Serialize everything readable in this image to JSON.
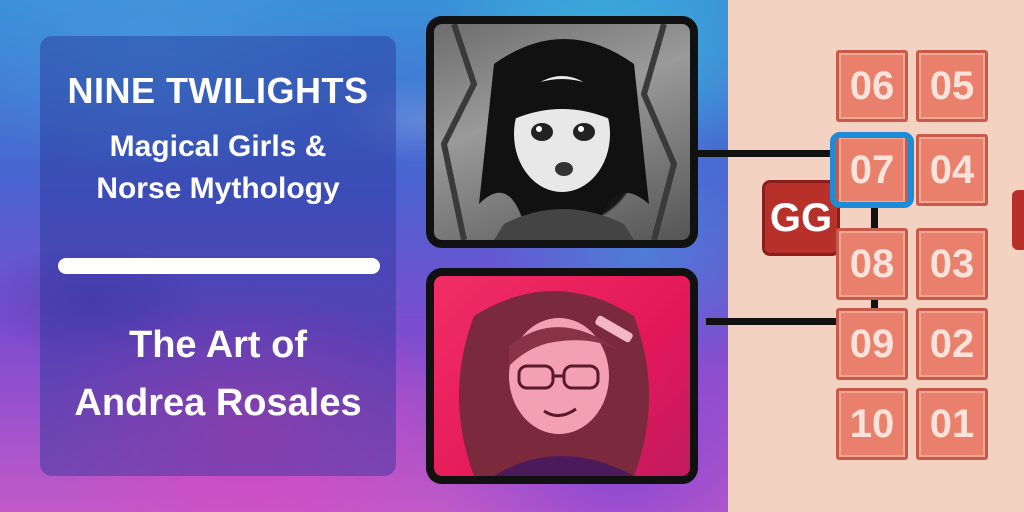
{
  "panel": {
    "title": "NINE TWILIGHTS",
    "subtitle_line1": "Magical Girls &",
    "subtitle_line2": "Norse Mythology",
    "credit_line1": "The Art of",
    "credit_line2": "Andrea Rosales"
  },
  "artwork": {
    "top_image": "manga-girl-illustration-bw",
    "bottom_image": "artist-portrait-pink"
  },
  "seat_map": {
    "badge_label": "GG",
    "selected_seat": "07",
    "seats": [
      "06",
      "05",
      "07",
      "04",
      "08",
      "03",
      "09",
      "02",
      "10",
      "01"
    ]
  },
  "colors": {
    "tile_fill": "#e9806c",
    "selection_outline": "#1d8bd6",
    "badge_fill": "#b8302a",
    "pink_background": "#e3185a"
  }
}
